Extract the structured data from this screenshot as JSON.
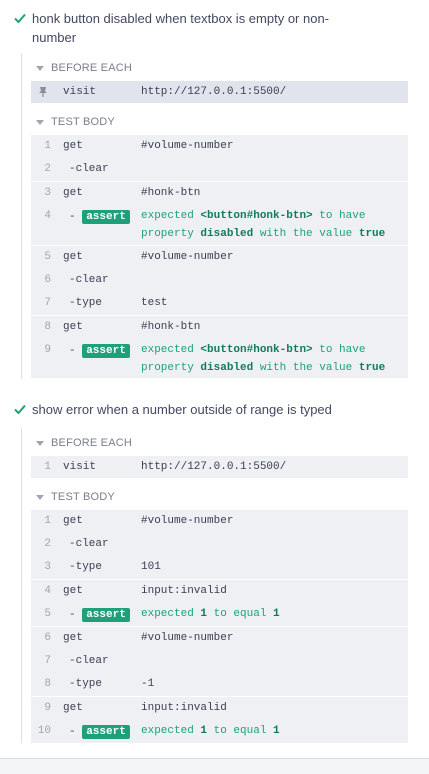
{
  "tests": [
    {
      "title": "honk button disabled when textbox is empty or non-number",
      "before_each": {
        "header": "BEFORE EACH",
        "cmd": "visit",
        "msg": "http://127.0.0.1:5500/"
      },
      "body": {
        "header": "TEST BODY",
        "rows": [
          {
            "n": "1",
            "cmd": "get",
            "msg": "#volume-number"
          },
          {
            "n": "2",
            "cmd": "clear",
            "msg": ""
          },
          {
            "n": "3",
            "cmd": "get",
            "msg": "#honk-btn"
          },
          {
            "n": "4",
            "cmd": "assert",
            "parts": [
              "expected ",
              "<button#honk-btn>",
              " to have property ",
              "disabled",
              " with the value ",
              "true"
            ]
          },
          {
            "n": "5",
            "cmd": "get",
            "msg": "#volume-number"
          },
          {
            "n": "6",
            "cmd": "clear",
            "msg": ""
          },
          {
            "n": "7",
            "cmd": "type",
            "msg": "test"
          },
          {
            "n": "8",
            "cmd": "get",
            "msg": "#honk-btn"
          },
          {
            "n": "9",
            "cmd": "assert",
            "parts": [
              "expected ",
              "<button#honk-btn>",
              " to have property ",
              "disabled",
              " with the value ",
              "true"
            ]
          }
        ]
      }
    },
    {
      "title": "show error when a number outside of range is typed",
      "before_each": {
        "header": "BEFORE EACH",
        "n": "1",
        "cmd": "visit",
        "msg": "http://127.0.0.1:5500/"
      },
      "body": {
        "header": "TEST BODY",
        "rows": [
          {
            "n": "1",
            "cmd": "get",
            "msg": "#volume-number"
          },
          {
            "n": "2",
            "cmd": "clear",
            "msg": ""
          },
          {
            "n": "3",
            "cmd": "type",
            "msg": "101"
          },
          {
            "n": "4",
            "cmd": "get",
            "msg": "input:invalid"
          },
          {
            "n": "5",
            "cmd": "assert",
            "parts": [
              "expected ",
              "1",
              " to equal ",
              "1"
            ]
          },
          {
            "n": "6",
            "cmd": "get",
            "msg": "#volume-number"
          },
          {
            "n": "7",
            "cmd": "clear",
            "msg": ""
          },
          {
            "n": "8",
            "cmd": "type",
            "msg": "-1"
          },
          {
            "n": "9",
            "cmd": "get",
            "msg": "input:invalid"
          },
          {
            "n": "10",
            "cmd": "assert",
            "parts": [
              "expected ",
              "1",
              " to equal ",
              "1"
            ]
          }
        ]
      }
    }
  ],
  "colors": {
    "pass": "#1ea17b",
    "row_bg": "#eef0f3"
  },
  "icons": {
    "status": "check-icon",
    "pinned": "pin-icon",
    "collapse": "caret-down-icon"
  }
}
